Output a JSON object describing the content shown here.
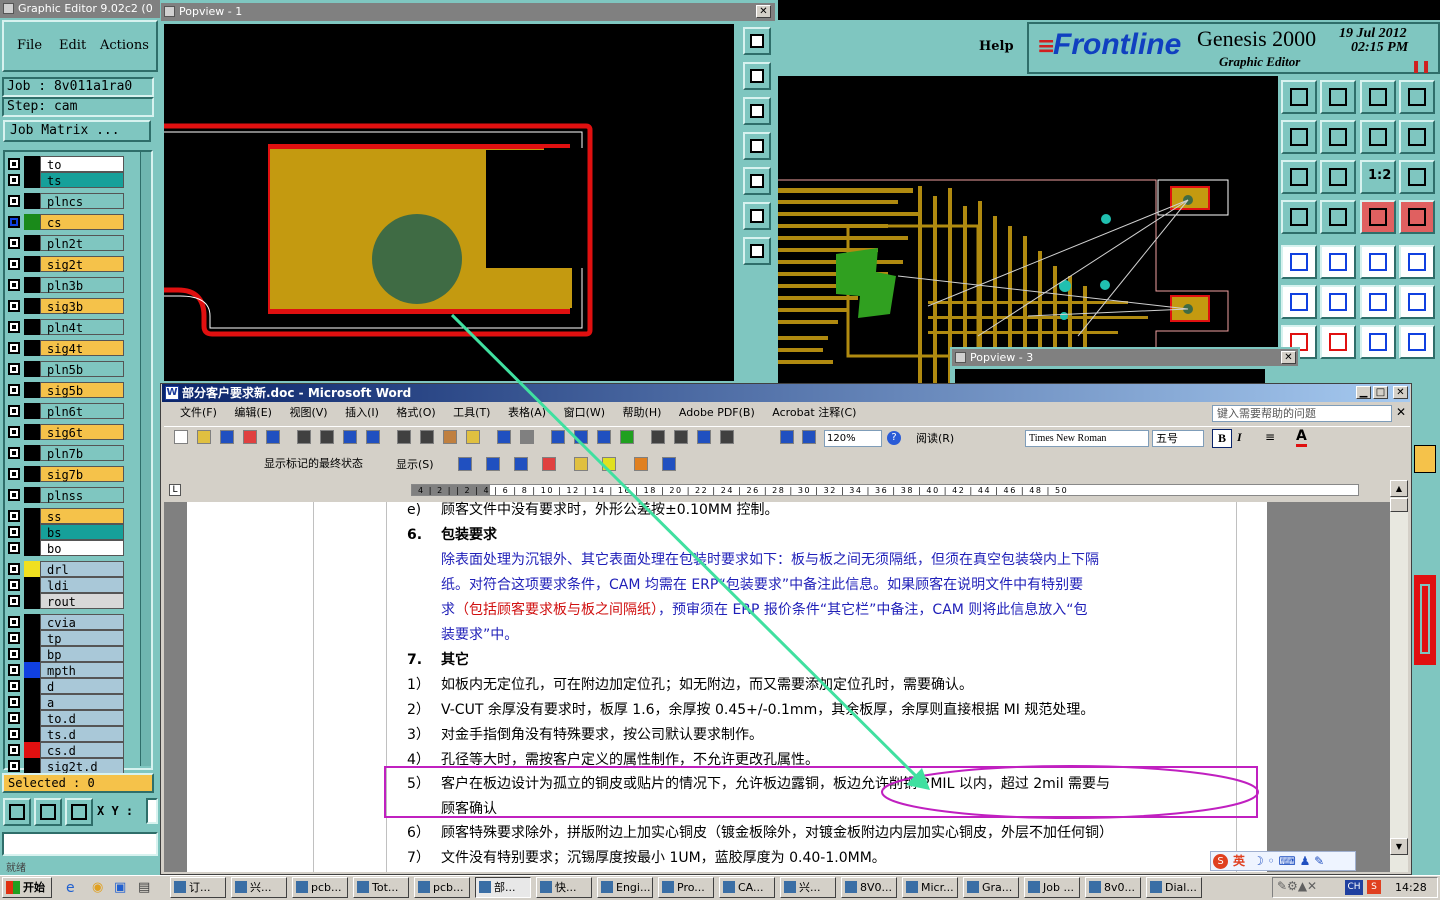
{
  "genesis": {
    "title": "Graphic Editor 9.02c2 (0",
    "menu": [
      "File",
      "Edit",
      "Actions"
    ],
    "help": "Help",
    "brand": "Frontline",
    "product": "Genesis 2000",
    "subtitle": "Graphic Editor",
    "date": "19 Jul 2012",
    "time": "02:15 PM",
    "job": "Job : 8v011a1ra0",
    "step": "Step: cam",
    "job_matrix": "Job Matrix ...",
    "selected": "Selected : 0",
    "xy": "X Y :",
    "layers": [
      {
        "name": "to",
        "color": "#ffffff"
      },
      {
        "name": "ts",
        "color": "#16a09a"
      },
      {
        "name": "plncs",
        "color": "#7fc6c0"
      },
      {
        "name": "cs",
        "color": "#f5c24a"
      },
      {
        "name": "pln2t",
        "color": "#7fc6c0"
      },
      {
        "name": "sig2t",
        "color": "#f5c24a"
      },
      {
        "name": "pln3b",
        "color": "#7fc6c0"
      },
      {
        "name": "sig3b",
        "color": "#f5c24a"
      },
      {
        "name": "pln4t",
        "color": "#7fc6c0"
      },
      {
        "name": "sig4t",
        "color": "#f5c24a"
      },
      {
        "name": "pln5b",
        "color": "#7fc6c0"
      },
      {
        "name": "sig5b",
        "color": "#f5c24a"
      },
      {
        "name": "pln6t",
        "color": "#7fc6c0"
      },
      {
        "name": "sig6t",
        "color": "#f5c24a"
      },
      {
        "name": "pln7b",
        "color": "#7fc6c0"
      },
      {
        "name": "sig7b",
        "color": "#f5c24a"
      },
      {
        "name": "plnss",
        "color": "#7fc6c0"
      },
      {
        "name": "ss",
        "color": "#f5c24a"
      },
      {
        "name": "bs",
        "color": "#16a09a"
      },
      {
        "name": "bo",
        "color": "#ffffff"
      },
      {
        "name": "drl",
        "color": "#a9c8d8"
      },
      {
        "name": "ldi",
        "color": "#a9c8d8"
      },
      {
        "name": "rout",
        "color": "#d8d8d8"
      },
      {
        "name": "cvia",
        "color": "#a9c8d8"
      },
      {
        "name": "tp",
        "color": "#a9c8d8"
      },
      {
        "name": "bp",
        "color": "#a9c8d8"
      },
      {
        "name": "mpth",
        "color": "#a9c8d8"
      },
      {
        "name": "d",
        "color": "#a9c8d8"
      },
      {
        "name": "a",
        "color": "#a9c8d8"
      },
      {
        "name": "to.d",
        "color": "#a9c8d8"
      },
      {
        "name": "ts.d",
        "color": "#a9c8d8"
      },
      {
        "name": "cs.d",
        "color": "#a9c8d8"
      },
      {
        "name": "sig2t.d",
        "color": "#a9c8d8"
      }
    ],
    "tool_icons": [
      "copy-icon",
      "step-icon",
      "home-icon",
      "screen-icon",
      "layer-left-icon",
      "layer-right-icon",
      "mirror-icon",
      "frame-icon",
      "fit-icon",
      "zoom-icon",
      "ratio-label",
      "help-icon",
      "ruler-icon",
      "grid-icon",
      "snap-icon",
      "snap-active-icon",
      "pad-icon",
      "route-icon",
      "measure-icon",
      "select-icon",
      "net-icon",
      "cross-icon",
      "pin-icon",
      "pin-alt-icon",
      "line-icon",
      "line-alt-icon",
      "rotate-icon",
      "flip-icon"
    ],
    "ratio_label": "1:2"
  },
  "popview1": {
    "title": "Popview - 1"
  },
  "popview3": {
    "title": "Popview - 3"
  },
  "word": {
    "title": "部分客户要求新.doc - Microsoft Word",
    "menu": [
      "文件(F)",
      "编辑(E)",
      "视图(V)",
      "插入(I)",
      "格式(O)",
      "工具(T)",
      "表格(A)",
      "窗口(W)",
      "帮助(H)",
      "Adobe PDF(B)",
      "Acrobat 注释(C)"
    ],
    "help_box": "键入需要帮助的问题",
    "zoom": "120%",
    "read_btn": "阅读(R)",
    "font": "Times New Roman",
    "size": "五号",
    "markup": "显示标记的最终状态",
    "show": "显示(S)",
    "ruler": "4 | 2 | | 2 | 4 | 6 | 8 | 10 | 12 | 14 | 16 | 18 | 20 | 22 | 24 | 26 | 28 | 30 | 32 | 34 | 36 | 38 | 40 | 42 | 44 | 46 | 48 | 50",
    "lines": [
      {
        "num": "e)",
        "text": "顾客文件中没有要求时，外形公差按±0.10MM 控制。",
        "style": ""
      },
      {
        "num": "6.",
        "text": "包装要求",
        "style": "bold"
      },
      {
        "num": "",
        "text": "除表面处理为沉银外、其它表面处理在包装时要求如下：板与板之间无须隔纸，但须在真空包装袋内上下隔",
        "style": "blue"
      },
      {
        "num": "",
        "text": "纸。对符合这项要求条件，CAM 均需在 ERP“包装要求”中备注此信息。如果顾客在说明文件中有特别要",
        "style": "blue"
      },
      {
        "num": "",
        "text": "求（包括顾客要求板与板之间隔纸），预审须在 ERP 报价条件“其它栏”中备注，CAM 则将此信息放入“包",
        "style": "blue-red"
      },
      {
        "num": "",
        "text": "装要求”中。",
        "style": "blue"
      },
      {
        "num": "7.",
        "text": "其它",
        "style": "bold"
      },
      {
        "num": "1）",
        "text": "如板内无定位孔，可在附边加定位孔；如无附边，而又需要添加定位孔时，需要确认。",
        "style": ""
      },
      {
        "num": "2）",
        "text": "V-CUT 余厚没有要求时，板厚 1.6，余厚按 0.45+/-0.1mm，其余板厚，余厚则直接根据 MI 规范处理。",
        "style": ""
      },
      {
        "num": "3）",
        "text": "对金手指倒角没有特殊要求，按公司默认要求制作。",
        "style": ""
      },
      {
        "num": "4）",
        "text": "孔径等大时，需按客户定义的属性制作，不允许更改孔属性。",
        "style": ""
      },
      {
        "num": "5）",
        "text": "客户在板边设计为孤立的铜皮或贴片的情况下，允许板边露铜，板边允许削铜 2MIL 以内，超过 2mil 需要与",
        "style": ""
      },
      {
        "num": "",
        "text": "顾客确认",
        "style": ""
      },
      {
        "num": "6）",
        "text": "顾客特殊要求除外，拼版附边上加实心铜皮（镀金板除外，对镀金板附边内层加实心铜皮，外层不加任何铜）",
        "style": ""
      },
      {
        "num": "7）",
        "text": "文件没有特别要求；沉锡厚度按最小 1UM，蓝胶厚度为 0.40-1.0MM。",
        "style": ""
      }
    ],
    "red_phrase": "（包括顾客要求板与板之间隔纸）",
    "ime": "英"
  },
  "taskbar": {
    "start": "开始",
    "items": [
      "订...",
      "兴...",
      "pcb...",
      "Tot...",
      "pcb...",
      "部...",
      "快...",
      "Engi...",
      "Pro...",
      "CA...",
      "兴...",
      "8V0...",
      "Micr...",
      "Gra...",
      "Job ...",
      "8v0...",
      "Dial..."
    ],
    "lang": "CH",
    "clock": "14:28",
    "status": "就绪"
  }
}
